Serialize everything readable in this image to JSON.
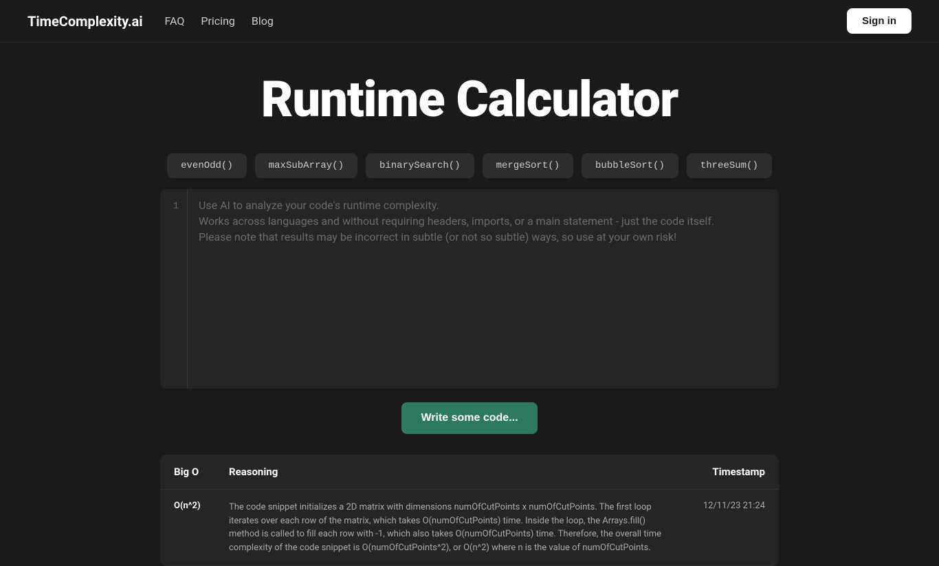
{
  "site": {
    "logo": "TimeComplexity.ai",
    "nav": [
      {
        "label": "FAQ",
        "href": "#"
      },
      {
        "label": "Pricing",
        "href": "#"
      },
      {
        "label": "Blog",
        "href": "#"
      }
    ],
    "sign_in_label": "Sign in"
  },
  "hero": {
    "title": "Runtime Calculator"
  },
  "example_tabs": [
    {
      "label": "evenOdd()"
    },
    {
      "label": "maxSubArray()"
    },
    {
      "label": "binarySearch()"
    },
    {
      "label": "mergeSort()"
    },
    {
      "label": "bubbleSort()"
    },
    {
      "label": "threeSum()"
    }
  ],
  "editor": {
    "line_number": "1",
    "placeholder_line1": "Use AI to analyze your code's runtime complexity.",
    "placeholder_line2": "Works across languages and without requiring headers, imports, or a main statement - just the code itself.",
    "placeholder_line3": "Please note that results may be incorrect in subtle (or not so subtle) ways, so use at your own risk!"
  },
  "write_code_button": "Write some code...",
  "results_table": {
    "headers": {
      "big_o": "Big O",
      "reasoning": "Reasoning",
      "timestamp": "Timestamp"
    },
    "rows": [
      {
        "big_o": "O(n^2)",
        "reasoning": "The code snippet initializes a 2D matrix with dimensions numOfCutPoints x numOfCutPoints. The first loop iterates over each row of the matrix, which takes O(numOfCutPoints) time. Inside the loop, the Arrays.fill() method is called to fill each row with -1, which also takes O(numOfCutPoints) time. Therefore, the overall time complexity of the code snippet is O(numOfCutPoints^2), or O(n^2) where n is the value of numOfCutPoints.",
        "timestamp": "12/11/23 21:24"
      }
    ]
  }
}
